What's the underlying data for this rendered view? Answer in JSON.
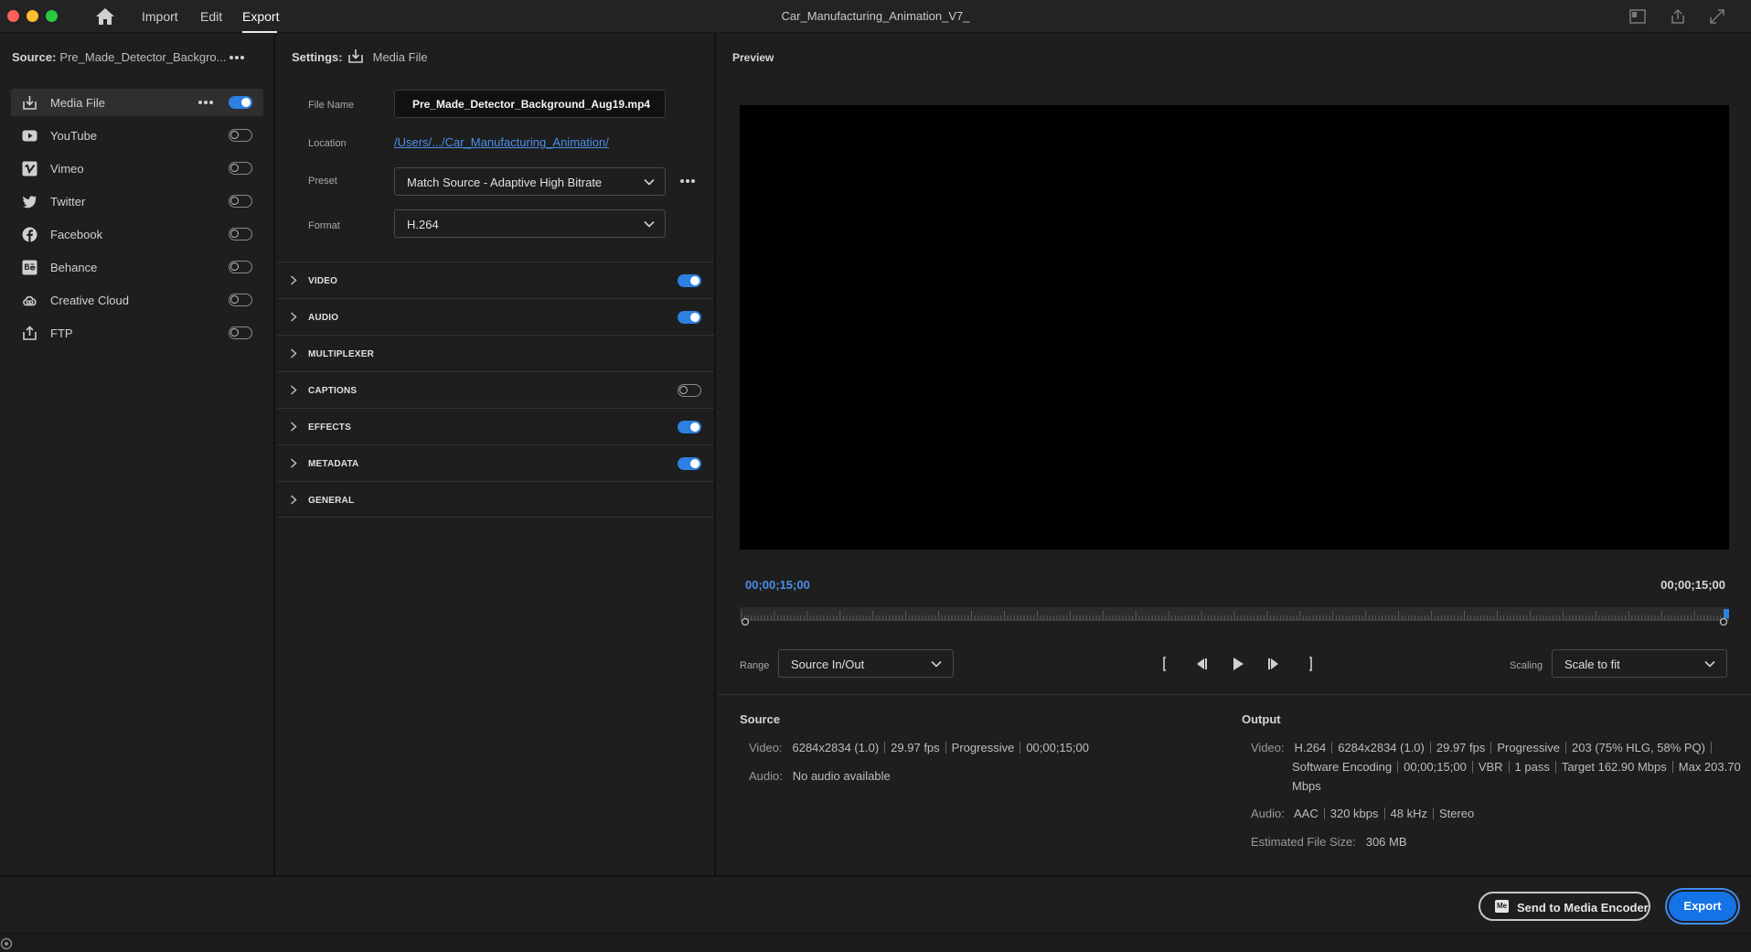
{
  "window": {
    "title": "Car_Manufacturing_Animation_V7_",
    "menu": {
      "import": "Import",
      "edit": "Edit",
      "export": "Export"
    }
  },
  "source": {
    "label": "Source:",
    "value": "Pre_Made_Detector_Backgro..."
  },
  "destinations": [
    {
      "label": "Media File",
      "enabled": true,
      "icon": "export-file-icon"
    },
    {
      "label": "YouTube",
      "enabled": false,
      "icon": "youtube-icon"
    },
    {
      "label": "Vimeo",
      "enabled": false,
      "icon": "vimeo-icon"
    },
    {
      "label": "Twitter",
      "enabled": false,
      "icon": "twitter-icon"
    },
    {
      "label": "Facebook",
      "enabled": false,
      "icon": "facebook-icon"
    },
    {
      "label": "Behance",
      "enabled": false,
      "icon": "behance-icon"
    },
    {
      "label": "Creative Cloud",
      "enabled": false,
      "icon": "creative-cloud-icon"
    },
    {
      "label": "FTP",
      "enabled": false,
      "icon": "upload-icon"
    }
  ],
  "settings": {
    "label": "Settings:",
    "target": "Media File",
    "file_name_label": "File Name",
    "file_name": "Pre_Made_Detector_Background_Aug19.mp4",
    "location_label": "Location",
    "location": "/Users/.../Car_Manufacturing_Animation/",
    "preset_label": "Preset",
    "preset": "Match Source - Adaptive High Bitrate",
    "format_label": "Format",
    "format": "H.264",
    "sections": [
      {
        "label": "VIDEO",
        "toggle": "on"
      },
      {
        "label": "AUDIO",
        "toggle": "on"
      },
      {
        "label": "MULTIPLEXER",
        "toggle": "none"
      },
      {
        "label": "CAPTIONS",
        "toggle": "off"
      },
      {
        "label": "EFFECTS",
        "toggle": "on"
      },
      {
        "label": "METADATA",
        "toggle": "on"
      },
      {
        "label": "GENERAL",
        "toggle": "none"
      }
    ]
  },
  "preview": {
    "title": "Preview",
    "timecode_current": "00;00;15;00",
    "timecode_duration": "00;00;15;00",
    "playhead_fraction": 1.0,
    "range_label": "Range",
    "range_value": "Source In/Out",
    "scaling_label": "Scaling",
    "scaling_value": "Scale to fit"
  },
  "source_info": {
    "title": "Source",
    "video_key": "Video:",
    "video_parts": [
      "6284x2834 (1.0)",
      "29.97 fps",
      "Progressive",
      "00;00;15;00"
    ],
    "audio_key": "Audio:",
    "audio_value": "No audio available"
  },
  "output_info": {
    "title": "Output",
    "video_key": "Video:",
    "video_line1": [
      "H.264",
      "6284x2834 (1.0)",
      "29.97 fps",
      "Progressive",
      "203 (75% HLG, 58% PQ)"
    ],
    "video_line2": [
      "Software Encoding",
      "00;00;15;00",
      "VBR",
      "1 pass",
      "Target 162.90 Mbps",
      "Max 203.70"
    ],
    "video_line3": "Mbps",
    "audio_key": "Audio:",
    "audio_parts": [
      "AAC",
      "320 kbps",
      "48 kHz",
      "Stereo"
    ],
    "size_key": "Estimated File Size:",
    "size_value": "306 MB"
  },
  "buttons": {
    "send_to_encoder": "Send to Media Encoder",
    "encoder_badge": "Me",
    "export": "Export"
  },
  "colors": {
    "accent": "#1473e6",
    "toggle_on": "#2d7fe0",
    "link": "#4b8fe8",
    "panel_bg": "#1e1e1e"
  }
}
